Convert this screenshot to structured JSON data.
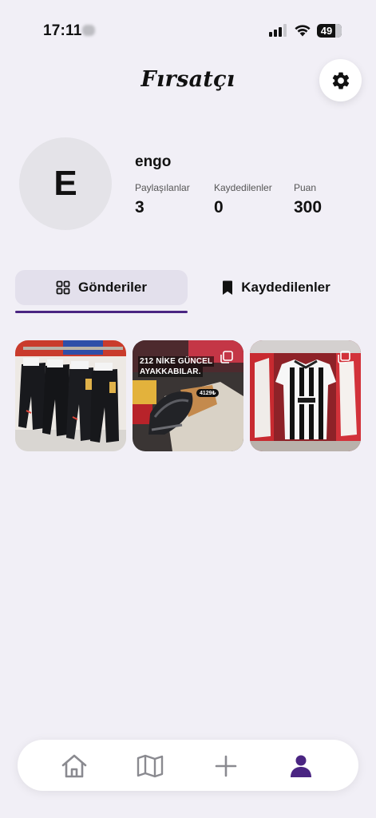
{
  "status_bar": {
    "time": "17:11",
    "battery": "49"
  },
  "header": {
    "title": "Fırsatçı",
    "settings_icon": "gear-icon"
  },
  "profile": {
    "avatar_initial": "E",
    "username": "engo",
    "stats": [
      {
        "label": "Paylaşılanlar",
        "value": "3"
      },
      {
        "label": "Kaydedilenler",
        "value": "0"
      },
      {
        "label": "Puan",
        "value": "300"
      }
    ]
  },
  "tabs": [
    {
      "label": "Gönderiler",
      "icon": "grid-icon",
      "active": true
    },
    {
      "label": "Kaydedilenler",
      "icon": "bookmark-icon",
      "active": false
    }
  ],
  "posts": [
    {
      "caption_lines": [],
      "multi": false
    },
    {
      "caption_lines": [
        "212 NİKE GÜNCEL",
        "AYAKKABILAR."
      ],
      "price": "4129₺",
      "multi": true
    },
    {
      "caption_lines": [],
      "multi": true
    }
  ],
  "nav": [
    {
      "icon": "home-icon",
      "active": false
    },
    {
      "icon": "map-icon",
      "active": false
    },
    {
      "icon": "plus-icon",
      "active": false
    },
    {
      "icon": "profile-icon",
      "active": true
    }
  ],
  "colors": {
    "accent": "#4a2582",
    "background": "#f1eff6",
    "tab_active_bg": "#e3e0ec"
  }
}
